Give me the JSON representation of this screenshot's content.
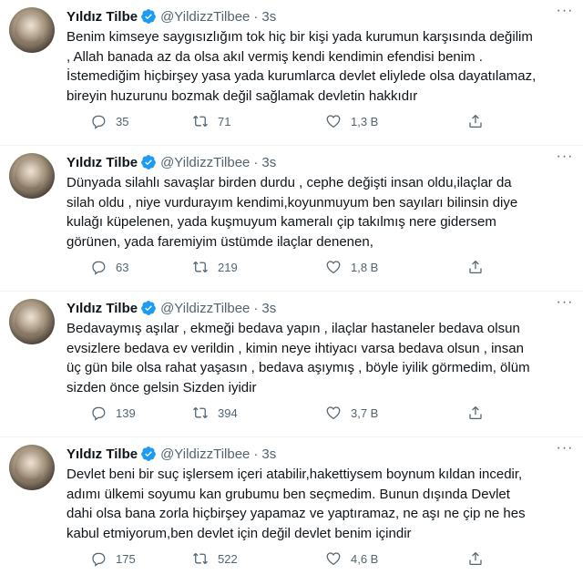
{
  "tweets": [
    {
      "name": "Yıldız Tilbe",
      "handle": "@YildizzTilbee",
      "time": "3s",
      "text": "Benim kimseye saygısızlığım tok hiç bir kişi yada kurumun karşısında değilim\n, Allah banada az da olsa akıl vermiş kendi kendimin efendisi benim .\nİstemediğim hiçbirşey yasa yada kurumlarca devlet eliylede olsa dayatılamaz,\nbireyin huzurunu bozmak değil sağlamak devletin hakkıdır",
      "replies": "35",
      "retweets": "71",
      "likes": "1,3 B"
    },
    {
      "name": "Yıldız Tilbe",
      "handle": "@YildizzTilbee",
      "time": "3s",
      "text": "Dünyada silahlı savaşlar birden durdu , cephe değişti insan oldu,ilaçlar da\nsilah oldu , niye vurdurayım kendimi,koyunmuyum ben sayıları bilinsin diye\nkulağı küpelenen, yada kuşmuyum kameralı çip takılmış nere gidersem\ngörünen, yada faremiyim üstümde ilaçlar denenen,",
      "replies": "63",
      "retweets": "219",
      "likes": "1,8 B"
    },
    {
      "name": "Yıldız Tilbe",
      "handle": "@YildizzTilbee",
      "time": "3s",
      "text": "Bedavaymış aşılar , ekmeği bedava yapın , ilaçlar hastaneler bedava olsun\nevsizlere bedava ev verildin , kimin neye ihtiyacı varsa bedava olsun , insan\nüç gün bile olsa rahat yaşasın , bedava aşıymış , böyle iyilik görmedim, ölüm\nsizden önce gelsin Sizden iyidir",
      "replies": "139",
      "retweets": "394",
      "likes": "3,7 B"
    },
    {
      "name": "Yıldız Tilbe",
      "handle": "@YildizzTilbee",
      "time": "3s",
      "text": "Devlet beni bir suç işlersem içeri atabilir,hakettiysem boynum kıldan incedir,\nadımı ülkemi soyumu  kan grubumu ben seçmedim. Bunun dışında Devlet\ndahi olsa bana zorla hiçbirşey yapamaz ve yaptıramaz, ne aşı ne çip ne hes\nkabul etmiyorum,ben devlet için değil devlet benim içindir",
      "replies": "175",
      "retweets": "522",
      "likes": "4,6 B"
    }
  ],
  "dot": "·",
  "colors": {
    "verified": "#1d9bf0",
    "muted": "#536471",
    "text": "#0f1419"
  }
}
